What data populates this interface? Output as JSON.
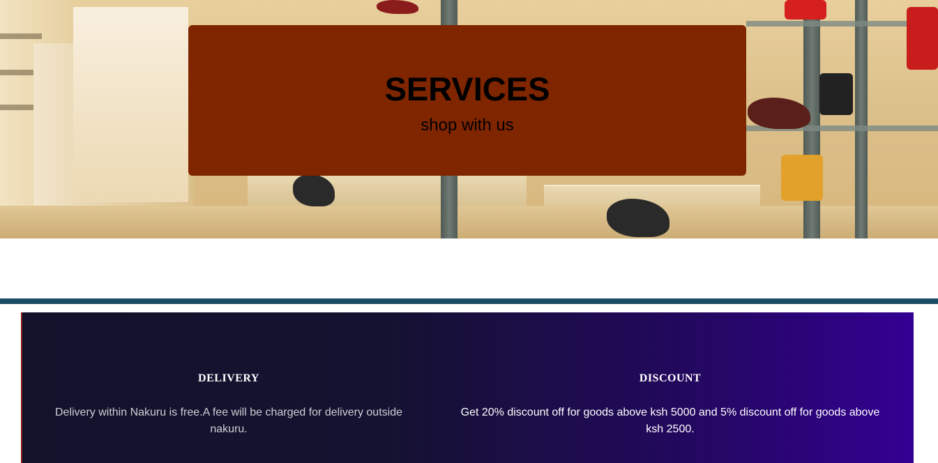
{
  "hero": {
    "title": "SERVICES",
    "subtitle": "shop with us",
    "card_color": "#7f2500"
  },
  "divider_color": "#1b4e66",
  "services": [
    {
      "heading": "DELIVERY",
      "text": "Delivery within Nakuru is free.A fee will be charged for delivery outside nakuru."
    },
    {
      "heading": "DISCOUNT",
      "text": "Get 20% discount off for goods above ksh 5000 and 5% discount off for goods above ksh 2500."
    }
  ],
  "panel_gradient": [
    "#13122b",
    "#330092"
  ]
}
